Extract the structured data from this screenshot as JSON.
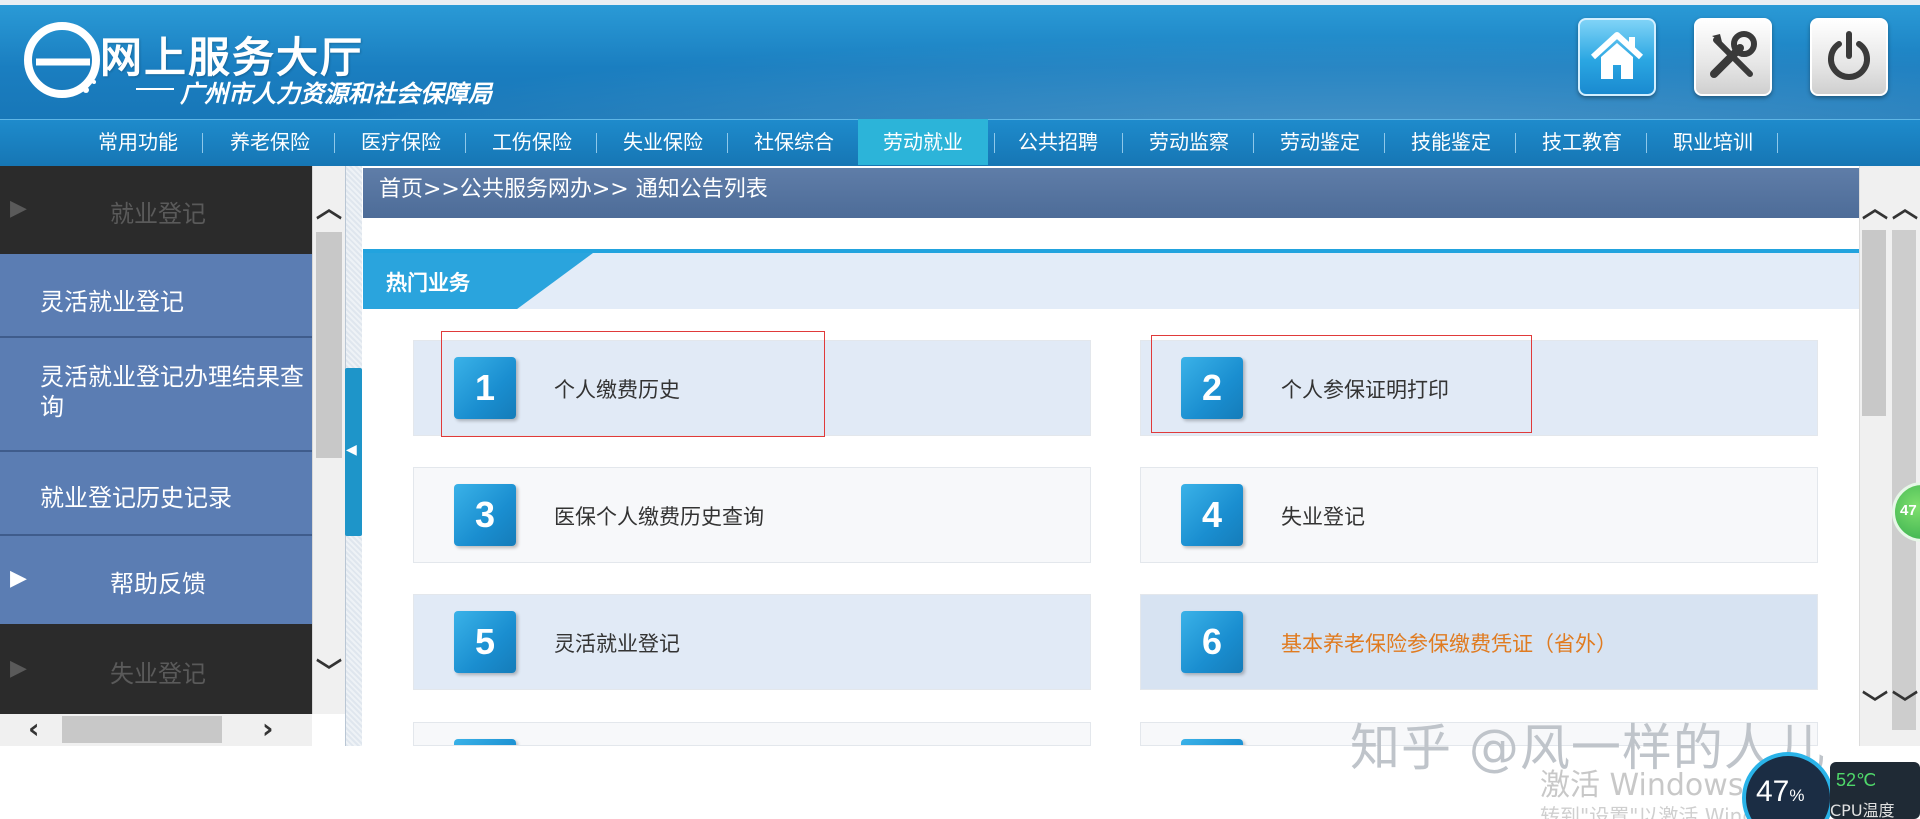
{
  "header": {
    "title": "网上服务大厅",
    "subtitle": "广州市人力资源和社会保障局",
    "buttons": [
      "home-icon",
      "tools-icon",
      "power-icon"
    ]
  },
  "nav": {
    "items": [
      "常用功能",
      "养老保险",
      "医疗保险",
      "工伤保险",
      "失业保险",
      "社保综合",
      "劳动就业",
      "公共招聘",
      "劳动监察",
      "劳动鉴定",
      "技能鉴定",
      "技工教育",
      "职业培训"
    ],
    "active": "劳动就业"
  },
  "sidebar": {
    "items": [
      {
        "label": "就业登记",
        "style": "dark-header"
      },
      {
        "label": "灵活就业登记",
        "style": "link"
      },
      {
        "label": "灵活就业登记办理结果查询",
        "style": "link"
      },
      {
        "label": "就业登记历史记录",
        "style": "link"
      },
      {
        "label": "帮助反馈",
        "style": "header"
      },
      {
        "label": "失业登记",
        "style": "dark-header"
      }
    ]
  },
  "breadcrumb": "首页>>公共服务网办>> 通知公告列表",
  "hot": {
    "title": "热门业务",
    "cards": [
      {
        "num": "1",
        "label": "个人缴费历史",
        "highlighted": true
      },
      {
        "num": "2",
        "label": "个人参保证明打印",
        "highlighted": true
      },
      {
        "num": "3",
        "label": "医保个人缴费历史查询"
      },
      {
        "num": "4",
        "label": "失业登记"
      },
      {
        "num": "5",
        "label": "灵活就业登记"
      },
      {
        "num": "6",
        "label": "基本养老保险参保缴费凭证（省外）",
        "hover": true
      }
    ]
  },
  "overlay": {
    "watermark": "知乎 @风一样的人儿",
    "activate_line1": "激活 Windows",
    "activate_line2": "转到\"设置\"以激活 Windows",
    "cpu_percent": "47",
    "cpu_percent_unit": "%",
    "cpu_temp": "52℃",
    "cpu_label": "CPU温度",
    "float_ball": "47"
  },
  "colors": {
    "header_blue": "#1a7ec0",
    "nav_active": "#2cb4d9",
    "sidebar_blue": "#5b7db3",
    "card_number_blue": "#1a8ed0",
    "hover_orange": "#e07b20",
    "highlight_red": "#e03a3a"
  }
}
